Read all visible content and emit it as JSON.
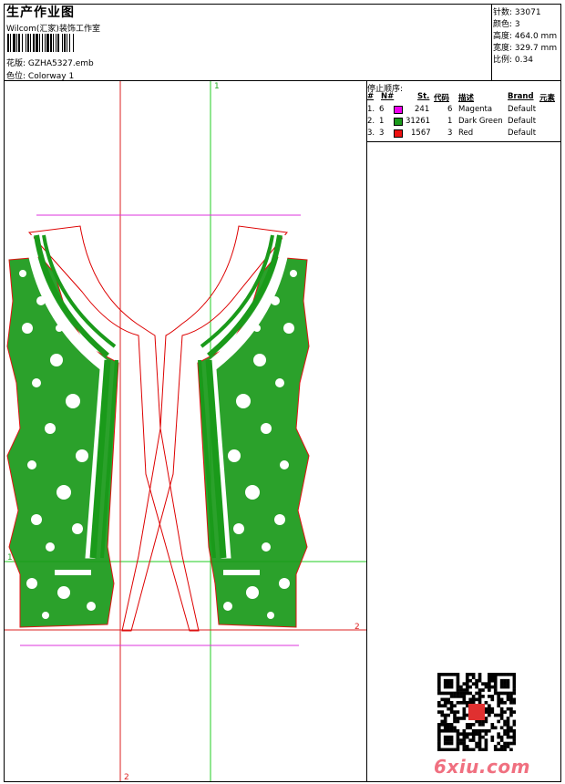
{
  "header": {
    "title": "生产作业图",
    "company": "Wilcom(汇家)装饰工作室",
    "design_label": "花版:",
    "design_value": "GZHA5327.emb",
    "colorway_label": "色位:",
    "colorway_value": "Colorway 1"
  },
  "stats": [
    {
      "label": "针数:",
      "value": "33071"
    },
    {
      "label": "颜色:",
      "value": "3"
    },
    {
      "label": "高度:",
      "value": "464.0 mm"
    },
    {
      "label": "宽度:",
      "value": "329.7 mm"
    },
    {
      "label": "比例:",
      "value": "0.34"
    }
  ],
  "stop_sequence": {
    "title": "停止顺序:",
    "headers": [
      "#",
      "N#",
      "St.",
      "代码",
      "描述",
      "Brand",
      "元素"
    ],
    "rows": [
      {
        "idx": "1.",
        "n": "6",
        "color": "#ee00ee",
        "st": "241",
        "code": "6",
        "desc": "Magenta",
        "brand": "Default"
      },
      {
        "idx": "2.",
        "n": "1",
        "color": "#1a9a1a",
        "st": "31261",
        "code": "1",
        "desc": "Dark Green",
        "brand": "Default"
      },
      {
        "idx": "3.",
        "n": "3",
        "color": "#ee1111",
        "st": "1567",
        "code": "3",
        "desc": "Red",
        "brand": "Default"
      }
    ]
  },
  "guides": {
    "green_v": "1",
    "green_h": "1",
    "red_h": "2",
    "red_v": "2"
  },
  "colors": {
    "green": "#1a9a1a",
    "red": "#dd0000",
    "magenta": "#dd33dd",
    "guide_green": "#22cc22",
    "guide_red": "#dd2222"
  },
  "watermark": "6xiu.com",
  "qr_stamp": "qr-code-icon"
}
